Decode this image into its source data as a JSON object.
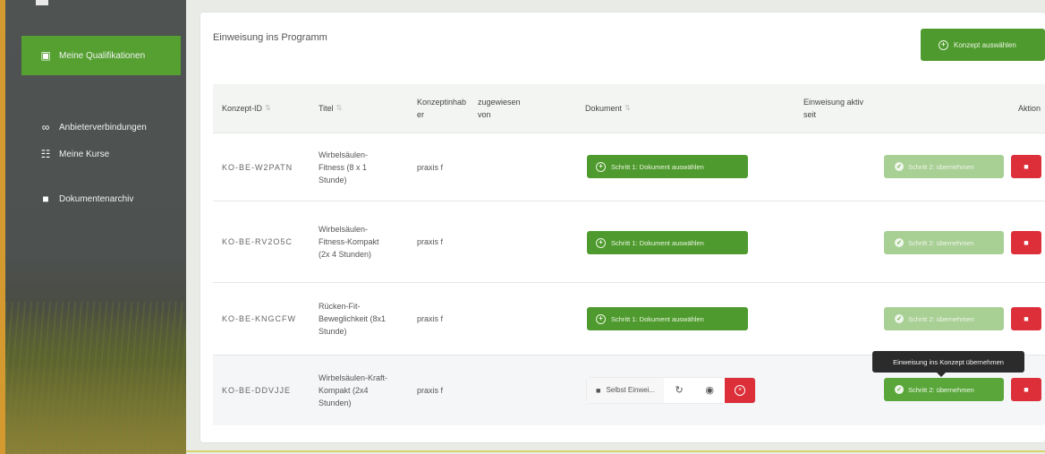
{
  "sidebar": {
    "items": [
      {
        "label": "Meine Qualifikationen",
        "icon": "certificate-icon",
        "active": true
      },
      {
        "label": "Anbieterverbindungen",
        "icon": "link-icon",
        "active": false
      },
      {
        "label": "Meine Kurse",
        "icon": "users-icon",
        "active": false
      },
      {
        "label": "Dokumentenarchiv",
        "icon": "folder-icon",
        "active": false
      }
    ]
  },
  "card": {
    "title": "Einweisung ins Programm",
    "top_button": "Konzept auswählen"
  },
  "table": {
    "headers": {
      "id": "Konzept-ID",
      "title": "Titel",
      "owner": "Konzeptinhab er",
      "assigned": "zugewiesen von",
      "document": "Dokument",
      "active": "Einweisung aktiv seit",
      "actions": "Aktion"
    },
    "sort_glyph": "⇅",
    "rows": [
      {
        "id": "KO-BE-W2PATN",
        "title": "Wirbelsäulen-Fitness (8 x 1 Stunde)",
        "owner": "praxis f",
        "step_button": "Schritt 1: Dokument auswählen",
        "over_button": "Schritt 2: übernehmen"
      },
      {
        "id": "KO-BE-RV2O5C",
        "title": "Wirbelsäulen-Fitness-Kompakt (2x 4 Stunden)",
        "owner": "praxis f",
        "step_button": "Schritt 1: Dokument auswählen",
        "over_button": "Schritt 2: übernehmen"
      },
      {
        "id": "KO-BE-KNGCFW",
        "title": "Rücken-Fit-Beweglichkeit (8x1 Stunde)",
        "owner": "praxis f",
        "step_button": "Schritt 1: Dokument auswählen",
        "over_button": "Schritt 2: übernehmen"
      },
      {
        "id": "KO-BE-DDVJJE",
        "title": "Wirbelsäulen-Kraft-Kompakt (2x4 Stunden)",
        "owner": "praxis f",
        "file_label": "Selbst Einwei...",
        "over_button": "Schritt 2: übernehmen"
      }
    ]
  },
  "tooltip": "Einweisung ins Konzept übernehmen",
  "colors": {
    "primary_green": "#4f9a2e",
    "disabled_green": "#a8cf94",
    "danger_red": "#dc2f3a",
    "sidebar_bg": "#4f5352"
  }
}
